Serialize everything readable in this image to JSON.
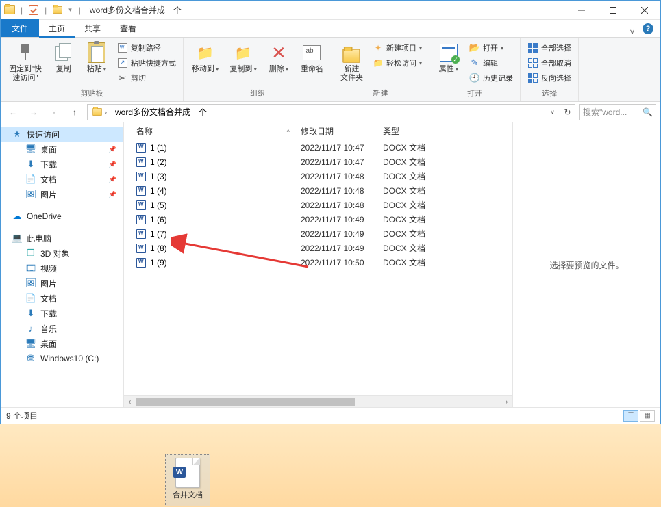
{
  "titlebar": {
    "title": "word多份文档合并成一个"
  },
  "tabs": {
    "file": "文件",
    "home": "主页",
    "share": "共享",
    "view": "查看"
  },
  "ribbon": {
    "pin_quick": "固定到\"快\n速访问\"",
    "copy": "复制",
    "paste": "粘贴",
    "copy_path": "复制路径",
    "paste_shortcut": "粘贴快捷方式",
    "cut": "剪切",
    "group_clipboard": "剪贴板",
    "move_to": "移动到",
    "copy_to": "复制到",
    "delete": "删除",
    "rename": "重命名",
    "group_organize": "组织",
    "new_folder": "新建\n文件夹",
    "new_item": "新建项目",
    "easy_access": "轻松访问",
    "group_new": "新建",
    "properties": "属性",
    "open": "打开",
    "edit": "编辑",
    "history": "历史记录",
    "group_open": "打开",
    "select_all": "全部选择",
    "select_none": "全部取消",
    "invert_sel": "反向选择",
    "group_select": "选择"
  },
  "address": {
    "path_seg": "word多份文档合并成一个"
  },
  "search": {
    "placeholder": "搜索\"word..."
  },
  "nav": {
    "quick_access": "快速访问",
    "desktop": "桌面",
    "downloads": "下载",
    "documents": "文档",
    "pictures": "图片",
    "onedrive": "OneDrive",
    "this_pc": "此电脑",
    "objects3d": "3D 对象",
    "videos": "视频",
    "pictures2": "图片",
    "documents2": "文档",
    "downloads2": "下载",
    "music": "音乐",
    "desktop2": "桌面",
    "drive_c": "Windows10 (C:)"
  },
  "columns": {
    "name": "名称",
    "date": "修改日期",
    "type": "类型"
  },
  "files": [
    {
      "name": "1 (1)",
      "date": "2022/11/17 10:47",
      "type": "DOCX 文档"
    },
    {
      "name": "1 (2)",
      "date": "2022/11/17 10:47",
      "type": "DOCX 文档"
    },
    {
      "name": "1 (3)",
      "date": "2022/11/17 10:48",
      "type": "DOCX 文档"
    },
    {
      "name": "1 (4)",
      "date": "2022/11/17 10:48",
      "type": "DOCX 文档"
    },
    {
      "name": "1 (5)",
      "date": "2022/11/17 10:48",
      "type": "DOCX 文档"
    },
    {
      "name": "1 (6)",
      "date": "2022/11/17 10:49",
      "type": "DOCX 文档"
    },
    {
      "name": "1 (7)",
      "date": "2022/11/17 10:49",
      "type": "DOCX 文档"
    },
    {
      "name": "1 (8)",
      "date": "2022/11/17 10:49",
      "type": "DOCX 文档"
    },
    {
      "name": "1 (9)",
      "date": "2022/11/17 10:50",
      "type": "DOCX 文档"
    }
  ],
  "preview": {
    "empty": "选择要预览的文件。"
  },
  "status": {
    "count": "9 个项目"
  },
  "desktop_icon": {
    "label": "合并文档"
  },
  "search_icon": "🔍"
}
